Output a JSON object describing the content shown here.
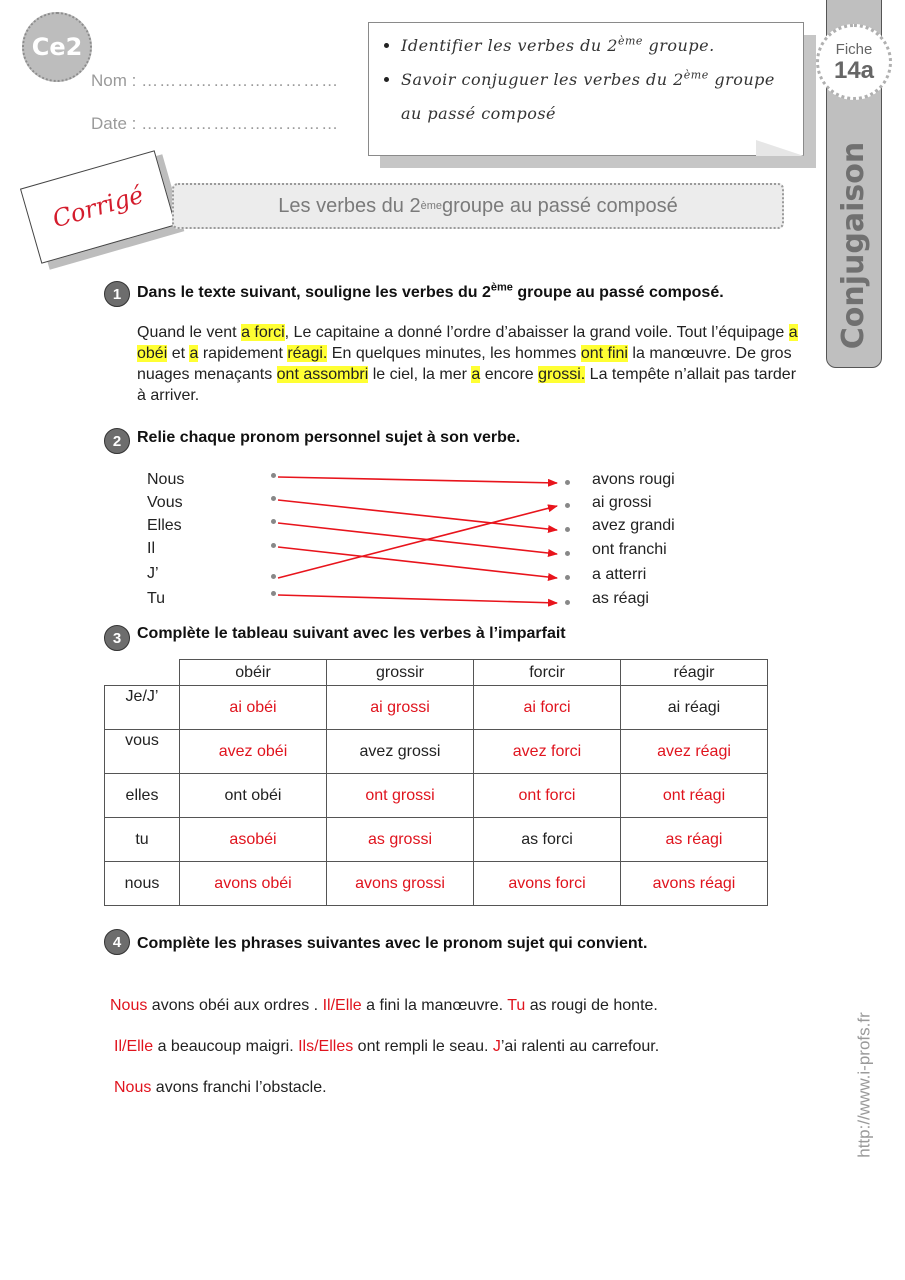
{
  "header": {
    "level": "Ce2",
    "nom_label": "Nom :",
    "nom_dots": "……………………………",
    "date_label": "Date :",
    "date_dots": "……………………………",
    "objectives": [
      {
        "pre": "Identifier les verbes du 2",
        "sup": "ème",
        "post": " groupe."
      },
      {
        "pre": "Savoir conjuguer les verbes du 2",
        "sup": "ème",
        "post": " groupe au passé composé"
      }
    ],
    "fiche_label": "Fiche",
    "fiche_number": "14a",
    "subject": "Conjugaison",
    "corrige_label": "Corrigé",
    "title": {
      "pre": "Les verbes du 2",
      "sup": "ème",
      "post": "  groupe au passé composé"
    }
  },
  "exercise1": {
    "number": "1",
    "title": {
      "pre": "Dans le texte suivant, souligne les verbes du 2",
      "sup": "ème",
      "post": " groupe au passé composé."
    },
    "passage": [
      {
        "t": "Quand le vent ",
        "h": false
      },
      {
        "t": "a forci",
        "h": true
      },
      {
        "t": ", Le capitaine a donné l’ordre d’abaisser la grand voile. Tout l’équipage ",
        "h": false
      },
      {
        "t": "a obéi",
        "h": true
      },
      {
        "t": " et ",
        "h": false
      },
      {
        "t": "a",
        "h": true
      },
      {
        "t": " rapidement ",
        "h": false
      },
      {
        "t": "réagi.",
        "h": true
      },
      {
        "t": " En quelques minutes, les hommes ",
        "h": false
      },
      {
        "t": "ont fini",
        "h": true
      },
      {
        "t": " la manœuvre. De gros nuages menaçants ",
        "h": false
      },
      {
        "t": "ont assombri",
        "h": true
      },
      {
        "t": " le ciel, la mer  ",
        "h": false
      },
      {
        "t": "a",
        "h": true
      },
      {
        "t": " encore ",
        "h": false
      },
      {
        "t": "grossi.",
        "h": true
      },
      {
        "t": " La tempête n’allait pas tarder à arriver.",
        "h": false
      }
    ],
    "highlight_color": "#ffff33"
  },
  "exercise2": {
    "number": "2",
    "title": "Relie chaque pronom personnel sujet à son verbe.",
    "pronouns": [
      "Nous",
      "Vous",
      "Elles",
      "Il",
      "J’",
      "Tu"
    ],
    "verbs": [
      "avons rougi",
      "ai grossi",
      "avez grandi",
      "ont franchi",
      "a atterri",
      "as réagi"
    ],
    "links": [
      [
        0,
        0
      ],
      [
        1,
        2
      ],
      [
        2,
        3
      ],
      [
        3,
        4
      ],
      [
        4,
        1
      ],
      [
        5,
        5
      ]
    ],
    "link_color": "#e8141c"
  },
  "exercise3": {
    "number": "3",
    "title": "Complète le tableau suivant avec les verbes à l’imparfait",
    "columns": [
      "obéir",
      "grossir",
      "forcir",
      "réagir"
    ],
    "rows": [
      {
        "pronoun": "Je/J’",
        "cells": [
          {
            "v": "ai obéi",
            "a": true
          },
          {
            "v": "ai grossi",
            "a": true
          },
          {
            "v": "ai forci",
            "a": true
          },
          {
            "v": "ai réagi",
            "a": false
          }
        ]
      },
      {
        "pronoun": "vous",
        "cells": [
          {
            "v": "avez obéi",
            "a": true
          },
          {
            "v": "avez grossi",
            "a": false
          },
          {
            "v": "avez forci",
            "a": true
          },
          {
            "v": "avez réagi",
            "a": true
          }
        ]
      },
      {
        "pronoun": "elles",
        "cells": [
          {
            "v": "ont obéi",
            "a": false
          },
          {
            "v": "ont grossi",
            "a": true
          },
          {
            "v": "ont forci",
            "a": true
          },
          {
            "v": "ont réagi",
            "a": true
          }
        ]
      },
      {
        "pronoun": "tu",
        "cells": [
          {
            "v": "asobéi",
            "a": true
          },
          {
            "v": "as grossi",
            "a": true
          },
          {
            "v": "as forci",
            "a": false
          },
          {
            "v": "as réagi",
            "a": true
          }
        ]
      },
      {
        "pronoun": "nous",
        "cells": [
          {
            "v": "avons obéi",
            "a": true
          },
          {
            "v": "avons grossi",
            "a": true
          },
          {
            "v": "avons forci",
            "a": true
          },
          {
            "v": "avons réagi",
            "a": true
          }
        ]
      }
    ],
    "answer_color": "#e0141e"
  },
  "exercise4": {
    "number": "4",
    "title": "Complète les phrases suivantes avec le pronom sujet qui  convient.",
    "lines": [
      [
        {
          "t": "Nous",
          "a": true
        },
        {
          "t": " avons obéi aux ordres . ",
          "a": false
        },
        {
          "t": "Il/Elle",
          "a": true
        },
        {
          "t": " a fini la manœuvre. ",
          "a": false
        },
        {
          "t": "Tu",
          "a": true
        },
        {
          "t": "  as  rougi de honte.",
          "a": false
        }
      ],
      [
        {
          "t": "Il/Elle",
          "a": true
        },
        {
          "t": " a beaucoup maigri. ",
          "a": false
        },
        {
          "t": "Ils/Elles",
          "a": true
        },
        {
          "t": "  ont rempli le seau. ",
          "a": false
        },
        {
          "t": "J",
          "a": true
        },
        {
          "t": "’ai ralenti au carrefour.",
          "a": false
        }
      ],
      [
        {
          "t": "Nous",
          "a": true
        },
        {
          "t": " avons franchi l’obstacle.",
          "a": false
        }
      ]
    ]
  },
  "footer": {
    "url": "http://www.i-profs.fr"
  }
}
